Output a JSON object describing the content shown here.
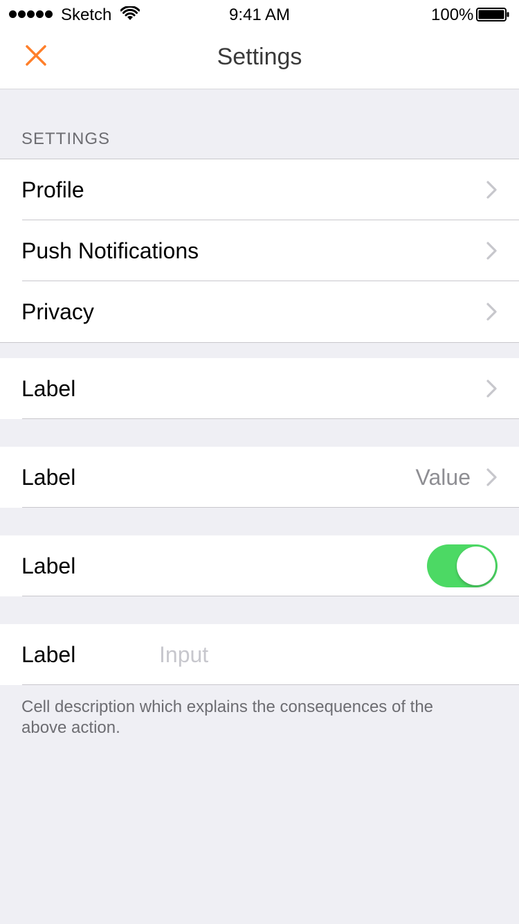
{
  "status_bar": {
    "carrier": "Sketch",
    "time": "9:41 AM",
    "battery_percent": "100%",
    "signal_bars": 5,
    "battery_level": 1.0
  },
  "nav": {
    "title": "Settings",
    "close_icon": "close-icon",
    "accent_color": "#FF7F2A"
  },
  "section": {
    "header": "SETTINGS",
    "items": [
      {
        "label": "Profile",
        "icon": "chevron-right-icon"
      },
      {
        "label": "Push Notifications",
        "icon": "chevron-right-icon"
      },
      {
        "label": "Privacy",
        "icon": "chevron-right-icon"
      }
    ]
  },
  "cells": {
    "disclosure": {
      "label": "Label",
      "icon": "chevron-right-icon"
    },
    "value_cell": {
      "label": "Label",
      "value": "Value",
      "icon": "chevron-right-icon"
    },
    "toggle_cell": {
      "label": "Label",
      "toggle_on": true,
      "toggle_color": "#4CD964"
    },
    "input_cell": {
      "label": "Label",
      "placeholder": "Input",
      "value": ""
    }
  },
  "description": "Cell description which explains the consequences of the above action."
}
